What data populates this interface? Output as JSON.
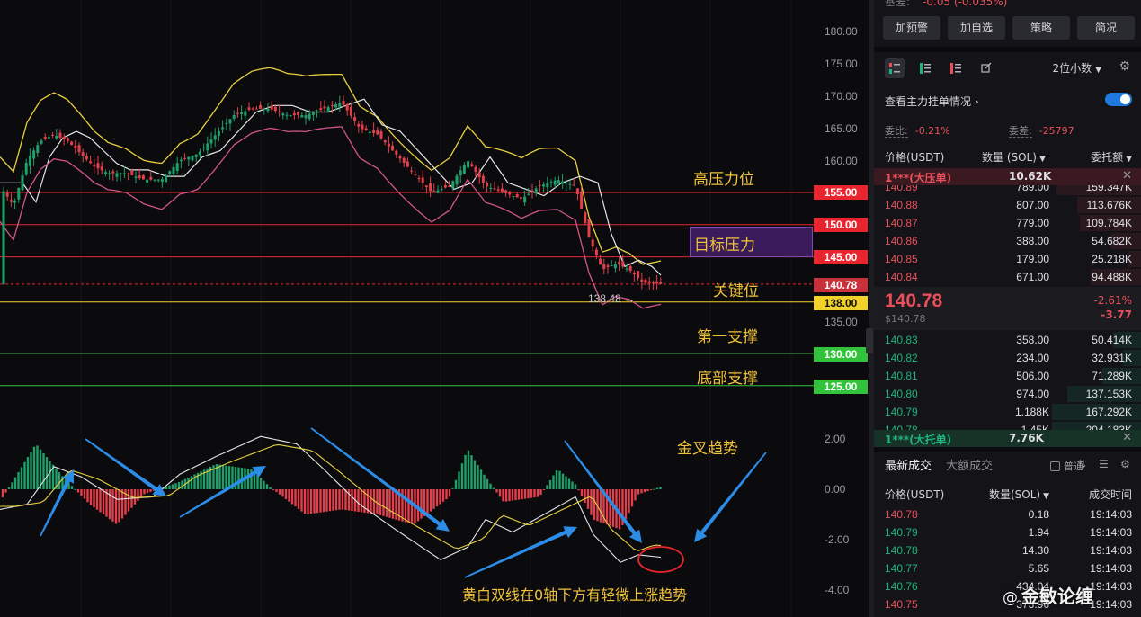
{
  "chart": {
    "y_axis_labels": [
      "180.00",
      "175.00",
      "170.00",
      "165.00",
      "160.00",
      "135.00",
      "2.00",
      "0.00",
      "-2.00",
      "-4.00"
    ],
    "price_tags": [
      {
        "label": "155.00",
        "bg": "#e8242e",
        "fg": "#ffffff"
      },
      {
        "label": "150.00",
        "bg": "#e8242e",
        "fg": "#ffffff"
      },
      {
        "label": "145.00",
        "bg": "#e8242e",
        "fg": "#ffffff"
      },
      {
        "label": "140.78",
        "bg": "#c8303a",
        "fg": "#ffffff"
      },
      {
        "label": "138.00",
        "bg": "#f2d22a",
        "fg": "#111111"
      },
      {
        "label": "130.00",
        "bg": "#33c23b",
        "fg": "#ffffff"
      },
      {
        "label": "125.00",
        "bg": "#33c23b",
        "fg": "#ffffff"
      }
    ],
    "low_marker": "138.48",
    "annotations": {
      "high_resistance": "高压力位",
      "target_resistance": "目标压力",
      "key_level": "关键位",
      "first_support": "第一支撑",
      "bottom_support": "底部支撑",
      "golden_cross": "金叉趋势",
      "macd_note": "黄白双线在0轴下方有轻微上涨趋势"
    },
    "colors": {
      "up": "#1fa06a",
      "down": "#e3404c",
      "bollinger": "#e8d040",
      "ma": "#e6e6e6",
      "lower_band": "#d2558a",
      "arrow": "#2b8de8"
    }
  },
  "panel": {
    "top_clip": {
      "label": "基差:",
      "value": "-0.05 (-0.035%)"
    },
    "actions": [
      "加预警",
      "加自选",
      "策略",
      "简况"
    ],
    "view_icons": [
      "both-book-icon",
      "bid-book-icon",
      "ask-book-icon",
      "trades-icon"
    ],
    "decimals": "2位小数",
    "main_orders_label": "查看主力挂单情况",
    "main_orders_toggle": "on",
    "ratio": {
      "label": "委比:",
      "value": "-0.21%"
    },
    "diff": {
      "label": "委差:",
      "value": "-25797"
    },
    "columns": {
      "price": "价格(USDT)",
      "qty": "数量 (SOL)",
      "total": "委托额"
    },
    "ask_banner": {
      "label": "1***(大压单)",
      "qty": "10.62K"
    },
    "asks": [
      {
        "p": "140.89",
        "q": "789.00",
        "t": "159.347K",
        "d": 0.55
      },
      {
        "p": "140.88",
        "q": "807.00",
        "t": "113.676K",
        "d": 0.42
      },
      {
        "p": "140.87",
        "q": "779.00",
        "t": "109.784K",
        "d": 0.4
      },
      {
        "p": "140.86",
        "q": "388.00",
        "t": "54.682K",
        "d": 0.2
      },
      {
        "p": "140.85",
        "q": "179.00",
        "t": "25.218K",
        "d": 0.09
      },
      {
        "p": "140.84",
        "q": "671.00",
        "t": "94.488K",
        "d": 0.33
      }
    ],
    "last_price": "140.78",
    "last_price_usd": "$140.78",
    "change_pct": "-2.61%",
    "change": "-3.77",
    "bids": [
      {
        "p": "140.83",
        "q": "358.00",
        "t": "50.414K",
        "d": 0.18
      },
      {
        "p": "140.82",
        "q": "234.00",
        "t": "32.931K",
        "d": 0.12
      },
      {
        "p": "140.81",
        "q": "506.00",
        "t": "71.289K",
        "d": 0.25
      },
      {
        "p": "140.80",
        "q": "974.00",
        "t": "137.153K",
        "d": 0.48
      },
      {
        "p": "140.79",
        "q": "1.188K",
        "t": "167.292K",
        "d": 0.58
      },
      {
        "p": "140.78",
        "q": "1.45K",
        "t": "204.183K",
        "d": 0.58
      }
    ],
    "bid_banner": {
      "label": "1***(大托单)",
      "qty": "7.76K"
    },
    "trade_tabs": [
      "最新成交",
      "大额成交"
    ],
    "normal_label": "普通",
    "trade_columns": {
      "price": "价格(USDT)",
      "qty": "数量(SOL)",
      "time": "成交时间"
    },
    "trades": [
      {
        "p": "140.78",
        "q": "0.18",
        "tm": "19:14:03",
        "dir": "dn"
      },
      {
        "p": "140.79",
        "q": "1.94",
        "tm": "19:14:03",
        "dir": "up"
      },
      {
        "p": "140.78",
        "q": "14.30",
        "tm": "19:14:03",
        "dir": "up"
      },
      {
        "p": "140.77",
        "q": "5.65",
        "tm": "19:14:03",
        "dir": "up"
      },
      {
        "p": "140.76",
        "q": "434.04",
        "tm": "19:14:03",
        "dir": "up"
      },
      {
        "p": "140.75",
        "q": "373.96",
        "tm": "19:14:03",
        "dir": "dn"
      }
    ]
  },
  "watermark": {
    "at": "@",
    "text": "金敏论缠"
  }
}
